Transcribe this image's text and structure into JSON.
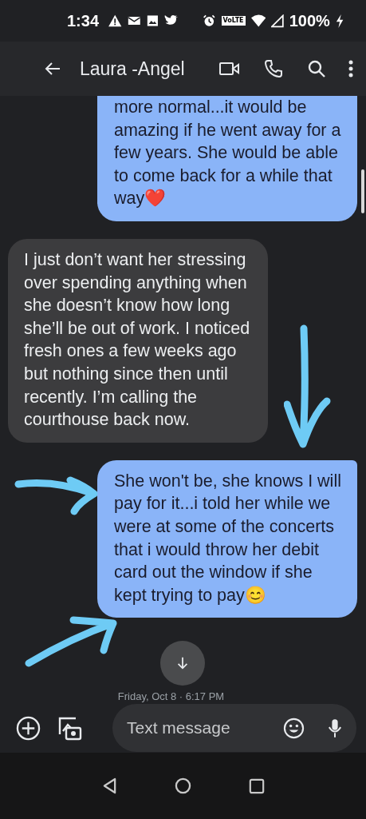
{
  "status_bar": {
    "time": "1:34",
    "network_badge": "VoLTE",
    "battery": "100%"
  },
  "header": {
    "title": "Laura -Angel"
  },
  "messages": [
    {
      "kind": "sent",
      "text": "more normal...it would be amazing if he went away for a few years. She would be able to come back for a while that way❤️"
    },
    {
      "kind": "received",
      "text": "I just don’t want her stressing over spending anything when she doesn’t know how long she’ll be out of work. I noticed fresh ones a few weeks ago but nothing since then until recently. I’m calling the courthouse back now."
    },
    {
      "kind": "sent",
      "text": "She won't be, she knows I will pay for it...i told her while we were at some of the concerts that i would throw her debit card out the window if she kept trying to pay😊"
    }
  ],
  "date_divider": "Friday, Oct 8 · 6:17 PM",
  "compose": {
    "placeholder": "Text message"
  }
}
